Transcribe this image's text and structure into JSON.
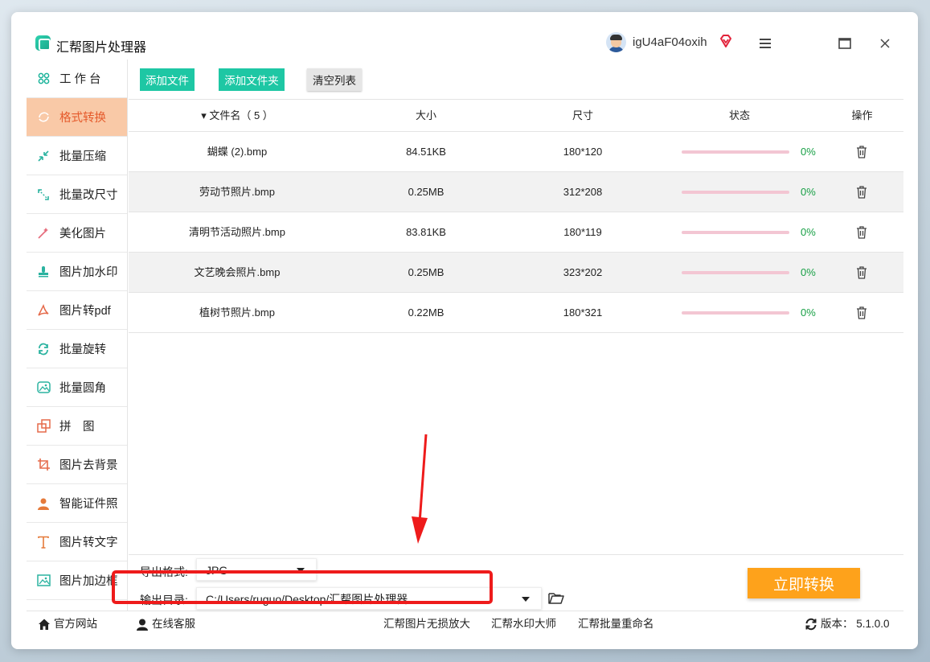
{
  "app": {
    "title": "汇帮图片处理器",
    "username": "igU4aF04oxih"
  },
  "sidebar": {
    "items": [
      {
        "label": "工 作 台",
        "icon": "grid-icon",
        "active": false
      },
      {
        "label": "格式转换",
        "icon": "convert-icon",
        "active": true
      },
      {
        "label": "批量压缩",
        "icon": "compress-icon",
        "active": false
      },
      {
        "label": "批量改尺寸",
        "icon": "resize-icon",
        "active": false
      },
      {
        "label": "美化图片",
        "icon": "beautify-icon",
        "active": false
      },
      {
        "label": "图片加水印",
        "icon": "watermark-icon",
        "active": false
      },
      {
        "label": "图片转pdf",
        "icon": "pdf-icon",
        "active": false
      },
      {
        "label": "批量旋转",
        "icon": "rotate-icon",
        "active": false
      },
      {
        "label": "批量圆角",
        "icon": "round-corner-icon",
        "active": false
      },
      {
        "label": "拼　图",
        "icon": "puzzle-icon",
        "active": false
      },
      {
        "label": "图片去背景",
        "icon": "crop-icon",
        "active": false
      },
      {
        "label": "智能证件照",
        "icon": "person-icon",
        "active": false
      },
      {
        "label": "图片转文字",
        "icon": "text-icon",
        "active": false
      },
      {
        "label": "图片加边框",
        "icon": "frame-icon",
        "active": false
      }
    ]
  },
  "toolbar": {
    "add_file": "添加文件",
    "add_folder": "添加文件夹",
    "clear_list": "清空列表"
  },
  "table": {
    "headers": {
      "name": "▾ 文件名（ 5 ）",
      "size": "大小",
      "dimensions": "尺寸",
      "status": "状态",
      "action": "操作"
    },
    "rows": [
      {
        "name": "蝴蝶 (2).bmp",
        "size": "84.51KB",
        "dimensions": "180*120",
        "progress": "0%"
      },
      {
        "name": "劳动节照片.bmp",
        "size": "0.25MB",
        "dimensions": "312*208",
        "progress": "0%"
      },
      {
        "name": "清明节活动照片.bmp",
        "size": "83.81KB",
        "dimensions": "180*119",
        "progress": "0%"
      },
      {
        "name": "文艺晚会照片.bmp",
        "size": "0.25MB",
        "dimensions": "323*202",
        "progress": "0%"
      },
      {
        "name": "植树节照片.bmp",
        "size": "0.22MB",
        "dimensions": "180*321",
        "progress": "0%"
      }
    ]
  },
  "options": {
    "format_label": "导出格式:",
    "format_value": "JPG",
    "output_label": "输出目录:",
    "output_value": "C:/Users/ruguo/Desktop/汇帮图片处理器",
    "convert_button": "立即转换"
  },
  "footer": {
    "website": "官方网站",
    "support": "在线客服",
    "link1": "汇帮图片无损放大",
    "link2": "汇帮水印大师",
    "link3": "汇帮批量重命名",
    "version": "版本： 5.1.0.0"
  },
  "colors": {
    "accent_green": "#1ec7a4",
    "active_nav_bg": "#f9c9a7",
    "active_nav_text": "#e55a2b",
    "convert_orange": "#fea21b",
    "highlight_red": "#ee1b1b"
  }
}
